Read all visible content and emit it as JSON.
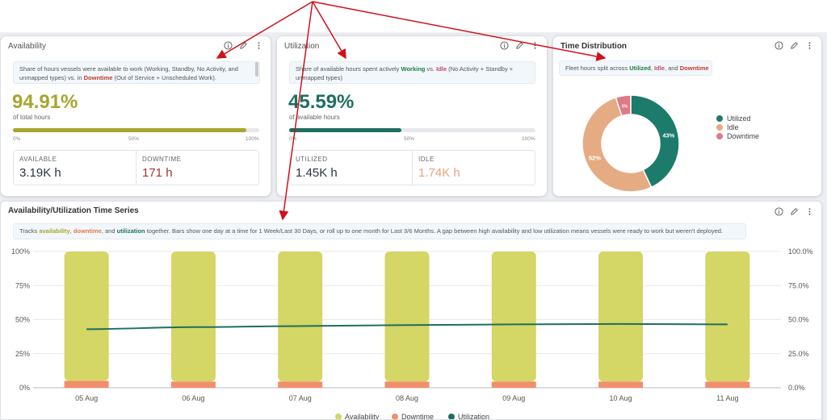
{
  "colors": {
    "availability": "#d4d665",
    "downtime": "#f28e6b",
    "utilization": "#1e6e61",
    "availability_text": "#a6a630",
    "downtime_text": "#c0392b",
    "utilized_donut": "#1d7b6b",
    "idle_donut": "#e5ab82",
    "downtime_donut": "#e07a86",
    "idle_stat": "#e5a67e",
    "annotation_arrow": "#d0111b"
  },
  "availability": {
    "title": "Availability",
    "desc_pre": "Share of hours vessels were available to work (Working, Standby, No Activity, and unmapped types) vs. in ",
    "desc_emph": "Downtime",
    "desc_post": " (Out of Service +",
    "desc_cut": "Unscheduled Work).",
    "value": "94.91%",
    "value_sub": "of total hours",
    "progress": 94.91,
    "ticks": [
      "0%",
      "50%",
      "100%"
    ],
    "stat1_label": "AVAILABLE",
    "stat1_value": "3.19K h",
    "stat2_label": "DOWNTIME",
    "stat2_value": "171 h"
  },
  "utilization": {
    "title": "Utilization",
    "desc_pre": "Share of available hours spent actively ",
    "desc_working": "Working",
    "desc_mid": " vs. ",
    "desc_idle": "Idle",
    "desc_post": " (No Activity + Standby + unmapped types)",
    "value": "45.59%",
    "value_sub": "of available hours",
    "progress": 45.59,
    "ticks": [
      "0%",
      "50%",
      "100%"
    ],
    "stat1_label": "UTILIZED",
    "stat1_value": "1.45K h",
    "stat2_label": "IDLE",
    "stat2_value": "1.74K h"
  },
  "time_distribution": {
    "title": "Time Distribution",
    "desc_pre": "Fleet hours split across ",
    "desc_utilized": "Utilized",
    "desc_sep": ", ",
    "desc_idle": "Idle",
    "desc_and": ", and ",
    "desc_downtime": "Downtime",
    "legend": [
      "Utilized",
      "Idle",
      "Downtime"
    ],
    "slice_labels": [
      "43%",
      "52%",
      "5%"
    ]
  },
  "timeseries": {
    "title": "Availability/Utilization Time Series",
    "desc_pre": "Tracks ",
    "desc_avail": "availability",
    "desc_sep1": ", ",
    "desc_down": "downtime",
    "desc_sep2": ", and ",
    "desc_util": "utilization",
    "desc_post": " together. Bars show one day at a time for 1 Week/Last 30 Days, or roll up to one month for Last 3/6 Months. A gap between high availability and low utilization means vessels were ready to work but weren't deployed.",
    "left_ticks": [
      "0%",
      "25%",
      "50%",
      "75%",
      "100%"
    ],
    "right_ticks": [
      "0.0%",
      "25.0%",
      "50.0%",
      "75.0%",
      "100.0%"
    ],
    "legend": [
      "Availability",
      "Downtime",
      "Utilization"
    ]
  },
  "chart_data": [
    {
      "type": "pie",
      "categories": [
        "Utilized",
        "Idle",
        "Downtime"
      ],
      "values": [
        43,
        52,
        5
      ],
      "donut": true
    },
    {
      "type": "bar",
      "categories": [
        "05 Aug",
        "06 Aug",
        "07 Aug",
        "08 Aug",
        "09 Aug",
        "10 Aug",
        "11 Aug"
      ],
      "ylim": [
        0,
        100
      ],
      "stacked": true,
      "legend_position": "bottom",
      "series": [
        {
          "name": "Availability",
          "kind": "bar",
          "values": [
            95,
            95.5,
            95.5,
            95.5,
            95.5,
            95.5,
            95.5
          ]
        },
        {
          "name": "Downtime",
          "kind": "bar",
          "values": [
            5,
            4.5,
            4.5,
            4.5,
            4.5,
            4.5,
            4.5
          ]
        },
        {
          "name": "Utilization",
          "kind": "line",
          "values": [
            43,
            44.5,
            45.3,
            46,
            46.5,
            46.8,
            46.5
          ]
        }
      ]
    }
  ]
}
